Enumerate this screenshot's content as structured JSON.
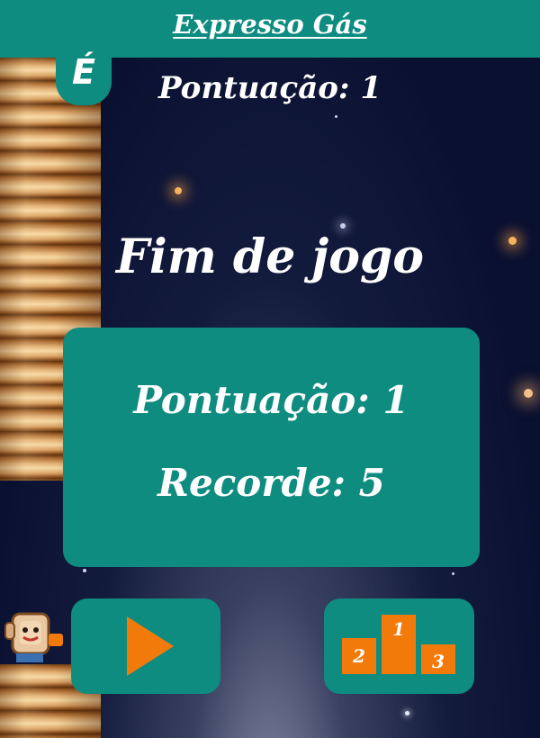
{
  "header": {
    "title": "Expresso Gás",
    "logo_letter": "É"
  },
  "hud": {
    "score": "Pontuação: 1"
  },
  "game_over": {
    "title": "Fim de jogo",
    "score": "Pontuação: 1",
    "record": "Recorde: 5"
  },
  "buttons": {
    "play": {
      "icon": "play-icon"
    },
    "leaderboard": {
      "icon": "podium-icon",
      "places": [
        "2",
        "1",
        "3"
      ]
    }
  },
  "colors": {
    "accent": "#0f8c80",
    "button_icon": "#f27a0a",
    "background": "#0b1230"
  }
}
